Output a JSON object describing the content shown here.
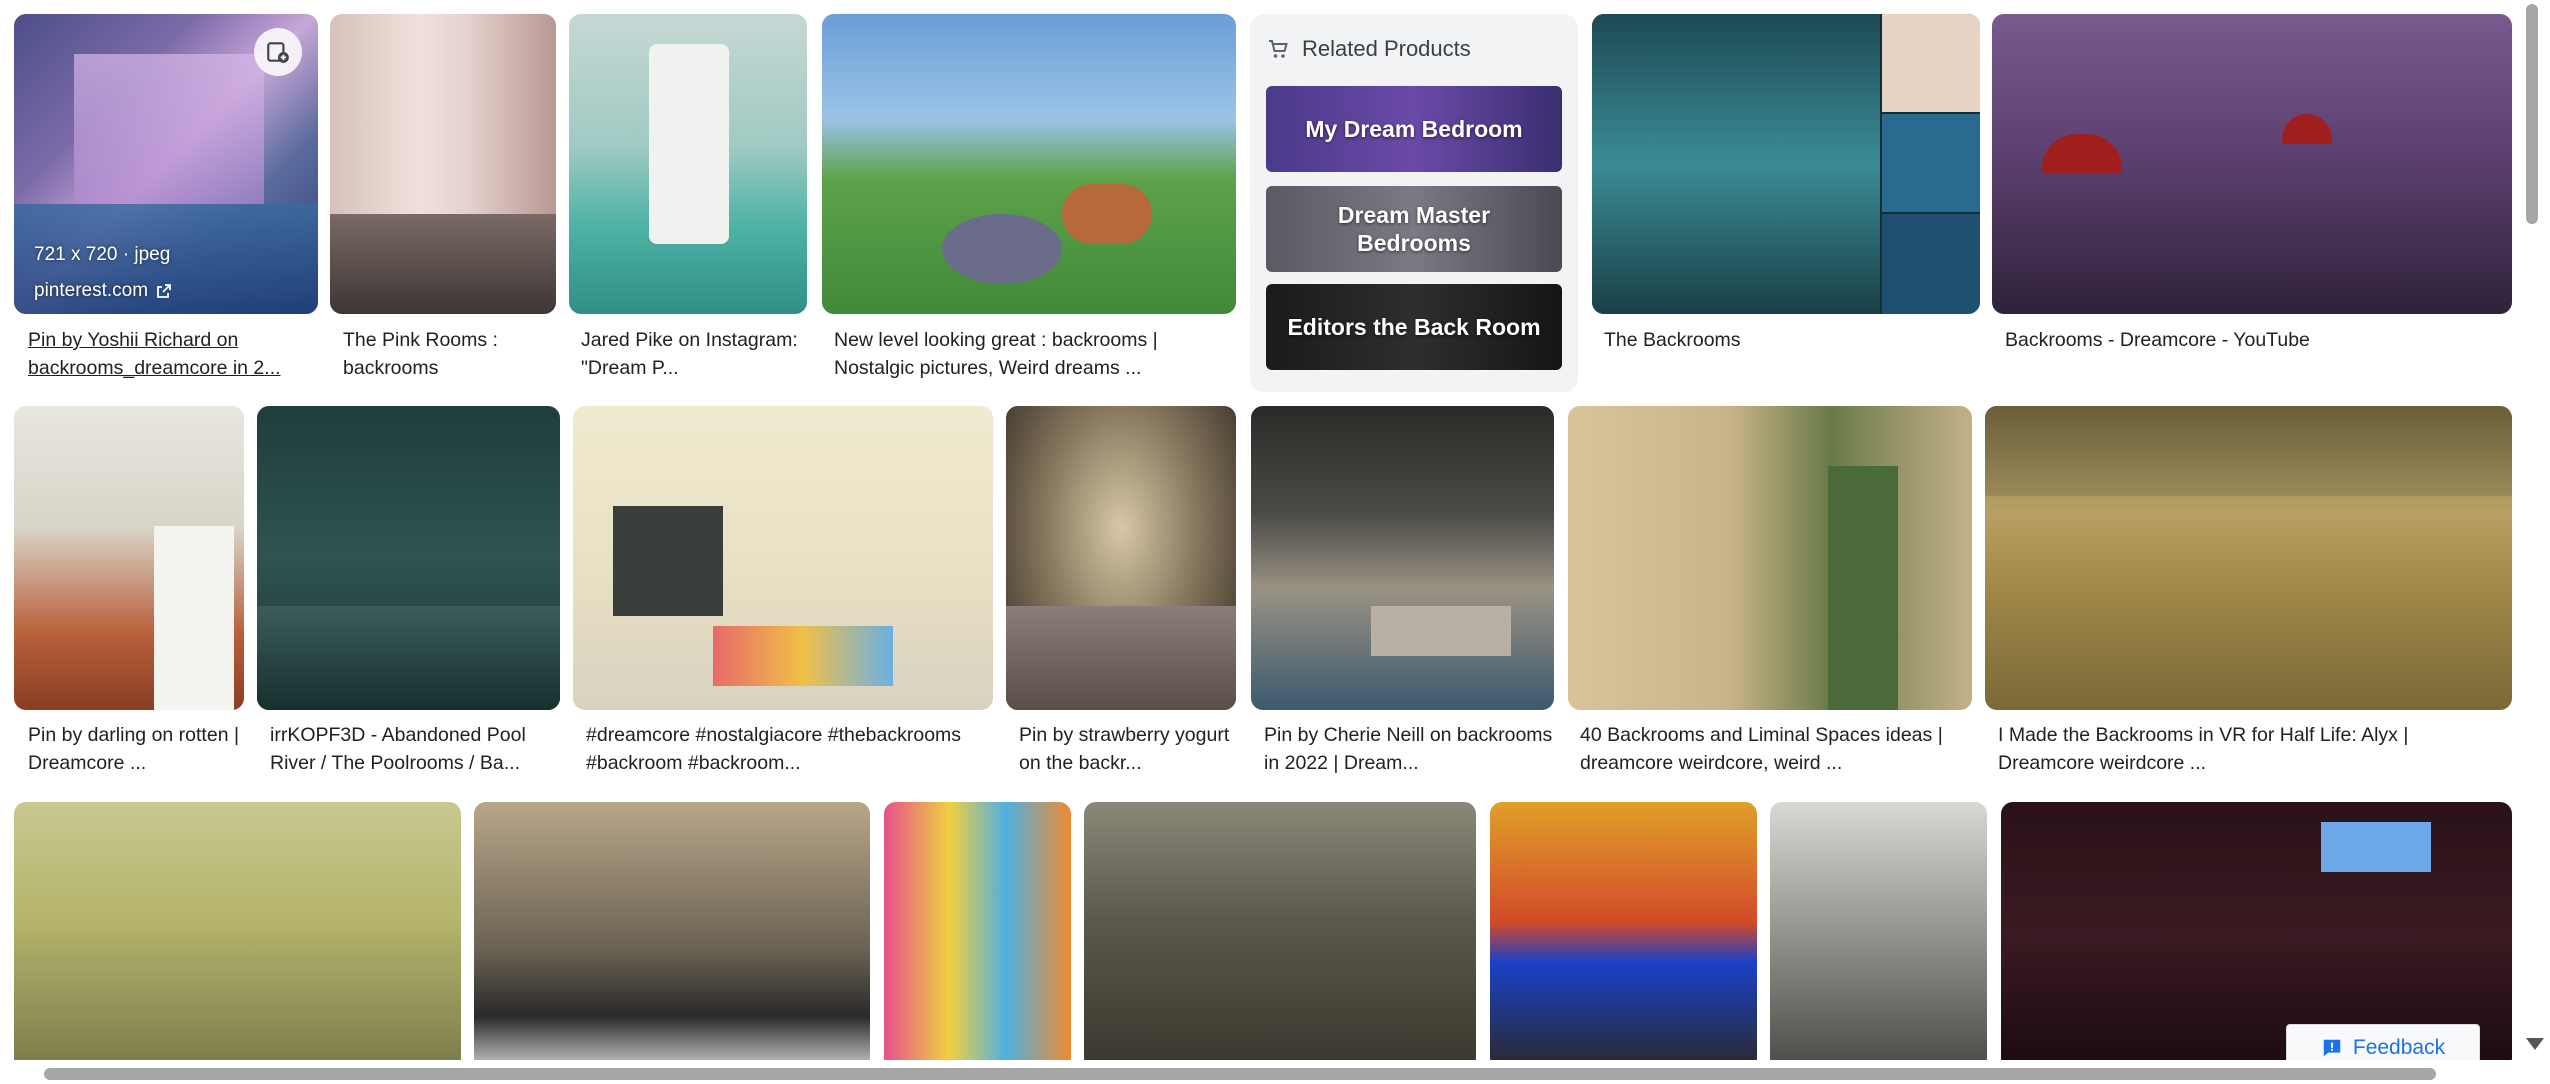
{
  "results": [
    {
      "caption": "Pin by Yoshii Richard on backrooms_dreamcore in 2..."
    },
    {
      "caption": "The Pink Rooms : backrooms"
    },
    {
      "caption": "Jared Pike on Instagram: \"Dream P..."
    },
    {
      "caption": "New level looking great : backrooms | Nostalgic pictures, Weird dreams ..."
    },
    {
      "caption": "The Backrooms"
    },
    {
      "caption": "Backrooms - Dreamcore - YouTube"
    },
    {
      "caption": "Pin by darling on rotten | Dreamcore ..."
    },
    {
      "caption": "irrKOPF3D - Abandoned Pool River / The Poolrooms / Ba..."
    },
    {
      "caption": "#dreamcore #nostalgiacore #thebackrooms #backroom #backroom..."
    },
    {
      "caption": "Pin by strawberry yogurt on the backr..."
    },
    {
      "caption": "Pin by Cherie Neill on backrooms in 2022 | Dream..."
    },
    {
      "caption": "40 Backrooms and Liminal Spaces ideas | dreamcore weirdcore, weird ..."
    },
    {
      "caption": "I Made the Backrooms in VR for Half Life: Alyx | Dreamcore weirdcore ..."
    }
  ],
  "hovered": {
    "dimensions": "721 x 720 · jpeg",
    "source": "pinterest.com"
  },
  "related": {
    "title": "Related Products",
    "items": [
      {
        "label": "My Dream Bedroom"
      },
      {
        "label": "Dream Master Bedrooms"
      },
      {
        "label": "Editors the Back Room"
      }
    ]
  },
  "feedback_label": "Feedback",
  "icons": [
    "save-to-collection-icon",
    "open-external-icon",
    "cart-icon",
    "feedback-icon"
  ]
}
